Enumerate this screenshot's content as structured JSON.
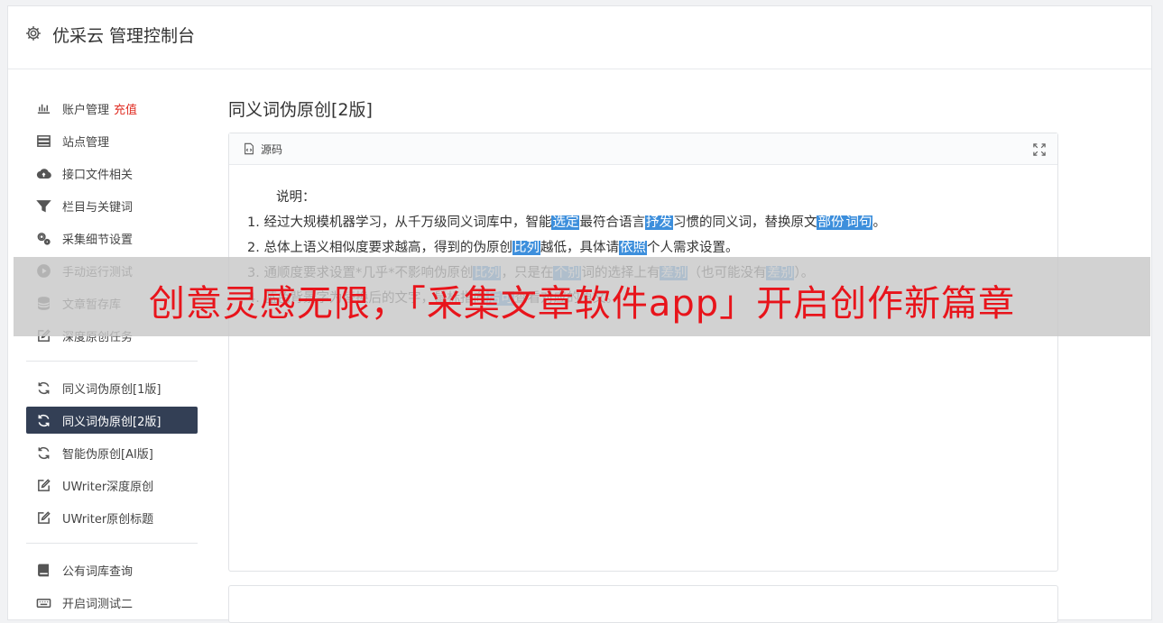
{
  "header": {
    "title": "优采云 管理控制台",
    "icon": "gear-icon"
  },
  "sidebar": {
    "group1": [
      {
        "icon": "bar-chart-icon",
        "label": "账户管理",
        "badge": "充值"
      },
      {
        "icon": "server-icon",
        "label": "站点管理"
      },
      {
        "icon": "cloud-upload-icon",
        "label": "接口文件相关"
      },
      {
        "icon": "filter-icon",
        "label": "栏目与关键词"
      },
      {
        "icon": "cogs-icon",
        "label": "采集细节设置"
      },
      {
        "icon": "play-circle-icon",
        "label": "手动运行测试"
      },
      {
        "icon": "database-icon",
        "label": "文章暂存库"
      },
      {
        "icon": "edit-icon",
        "label": "深度原创任务"
      }
    ],
    "group2": [
      {
        "icon": "refresh-icon",
        "label": "同义词伪原创[1版]"
      },
      {
        "icon": "refresh-icon",
        "label": "同义词伪原创[2版]",
        "active": true
      },
      {
        "icon": "refresh-icon",
        "label": "智能伪原创[AI版]"
      },
      {
        "icon": "edit-icon",
        "label": "UWriter深度原创"
      },
      {
        "icon": "edit-icon",
        "label": "UWriter原创标题"
      }
    ],
    "group3": [
      {
        "icon": "book-icon",
        "label": "公有词库查询"
      },
      {
        "icon": "keyboard-icon",
        "label": "开启词测试二"
      }
    ]
  },
  "main": {
    "title": "同义词伪原创[2版]",
    "editor": {
      "toolbar_label": "源码",
      "intro": "说明：",
      "lines": [
        [
          {
            "t": "1. 经过大规模机器学习，从千万级同义词库中，智能"
          },
          {
            "t": "选定",
            "hl": true
          },
          {
            "t": "最符合语言"
          },
          {
            "t": "抒发",
            "hl": true
          },
          {
            "t": "习惯的同义词，替换原文"
          },
          {
            "t": "部份",
            "hl": true
          },
          {
            "t": "词句",
            "hl": true
          },
          {
            "t": "。"
          }
        ],
        [
          {
            "t": "2. 总体上语义相似度要求越高，得到的伪原创"
          },
          {
            "t": "比列",
            "hl": true
          },
          {
            "t": "越低，具体请"
          },
          {
            "t": "依照",
            "hl": true
          },
          {
            "t": "个人需求设置。"
          }
        ],
        [
          {
            "t": "3. 通顺度要求设置*几乎*不影响伪原创"
          },
          {
            "t": "比列",
            "hl": true
          },
          {
            "t": "，只是在"
          },
          {
            "t": "个别",
            "hl": true
          },
          {
            "t": "词的选择上有"
          },
          {
            "t": "差别",
            "hl": true
          },
          {
            "t": "（也可能没有"
          },
          {
            "t": "差别",
            "hl": true
          },
          {
            "t": "）。"
          }
        ],
        [
          {
            "t": "4. 蓝色背景字为替换后的文字，鼠标指向"
          },
          {
            "t": "后可",
            "hl": true
          },
          {
            "t": "查看对应的原文。"
          }
        ]
      ]
    }
  },
  "overlay": {
    "text": "创意灵感无限，「采集文章软件app」开启创作新篇章"
  },
  "colors": {
    "active_bg": "#333f55",
    "highlight": "#3d8fdc",
    "overlay_text": "#e8141b",
    "badge": "#e02e24"
  }
}
